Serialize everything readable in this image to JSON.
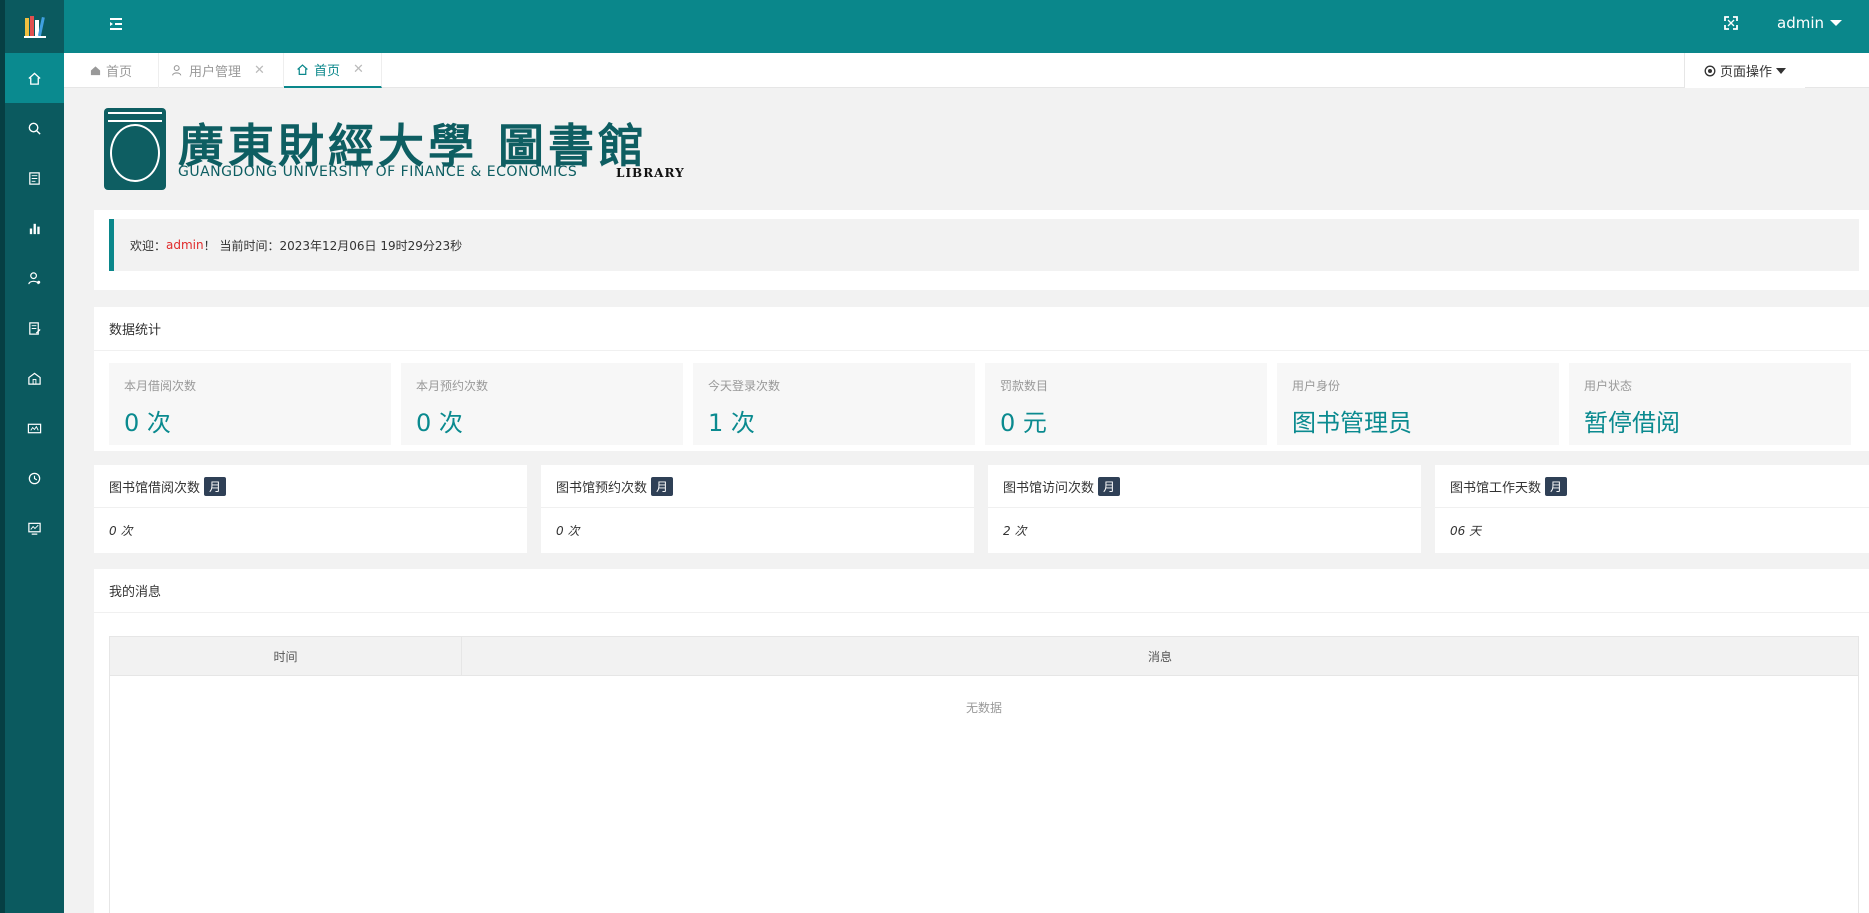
{
  "header": {
    "menu_toggle_icon": "indent-icon",
    "fullscreen_icon": "fullscreen-icon",
    "user_name": "admin",
    "colors": {
      "header": "#0a878b",
      "sidebar": "#0b5a5f",
      "accent": "#0a8a8f"
    }
  },
  "sidebar": {
    "logo_icon": "books-icon",
    "items": [
      {
        "icon": "home-icon",
        "active": true
      },
      {
        "icon": "search-icon"
      },
      {
        "icon": "book-doc-icon"
      },
      {
        "icon": "bar-chart-icon"
      },
      {
        "icon": "user-icon"
      },
      {
        "icon": "edit-doc-icon"
      },
      {
        "icon": "building-icon"
      },
      {
        "icon": "card-icon"
      },
      {
        "icon": "history-icon"
      },
      {
        "icon": "monitor-icon"
      }
    ]
  },
  "tabs": {
    "home_fixed": "首页",
    "user_mgmt": "用户管理",
    "home_active": "首页",
    "page_ops": "页面操作"
  },
  "banner": {
    "name_cn": "廣東財經大學 圖書館",
    "name_en": "GUANGDONG UNIVERSITY OF FINANCE & ECONOMICS",
    "name_lib": "LIBRARY"
  },
  "welcome": {
    "prefix": "欢迎：",
    "user": "admin",
    "mid": "！ 当前时间：",
    "time": "2023年12月06日 19时29分23秒"
  },
  "stats": {
    "title": "数据统计",
    "items": [
      {
        "label": "本月借阅次数",
        "value": "0 次"
      },
      {
        "label": "本月预约次数",
        "value": "0 次"
      },
      {
        "label": "今天登录次数",
        "value": "1 次"
      },
      {
        "label": "罚款数目",
        "value": "0 元"
      },
      {
        "label": "用户身份",
        "value": "图书管理员"
      },
      {
        "label": "用户状态",
        "value": "暂停借阅"
      }
    ]
  },
  "monthly": {
    "badge": "月",
    "items": [
      {
        "title": "图书馆借阅次数",
        "value": "0 次"
      },
      {
        "title": "图书馆预约次数",
        "value": "0 次"
      },
      {
        "title": "图书馆访问次数",
        "value": "2 次"
      },
      {
        "title": "图书馆工作天数",
        "value": "06 天"
      }
    ]
  },
  "messages": {
    "title": "我的消息",
    "columns": [
      "时间",
      "消息"
    ],
    "empty_text": "无数据"
  }
}
